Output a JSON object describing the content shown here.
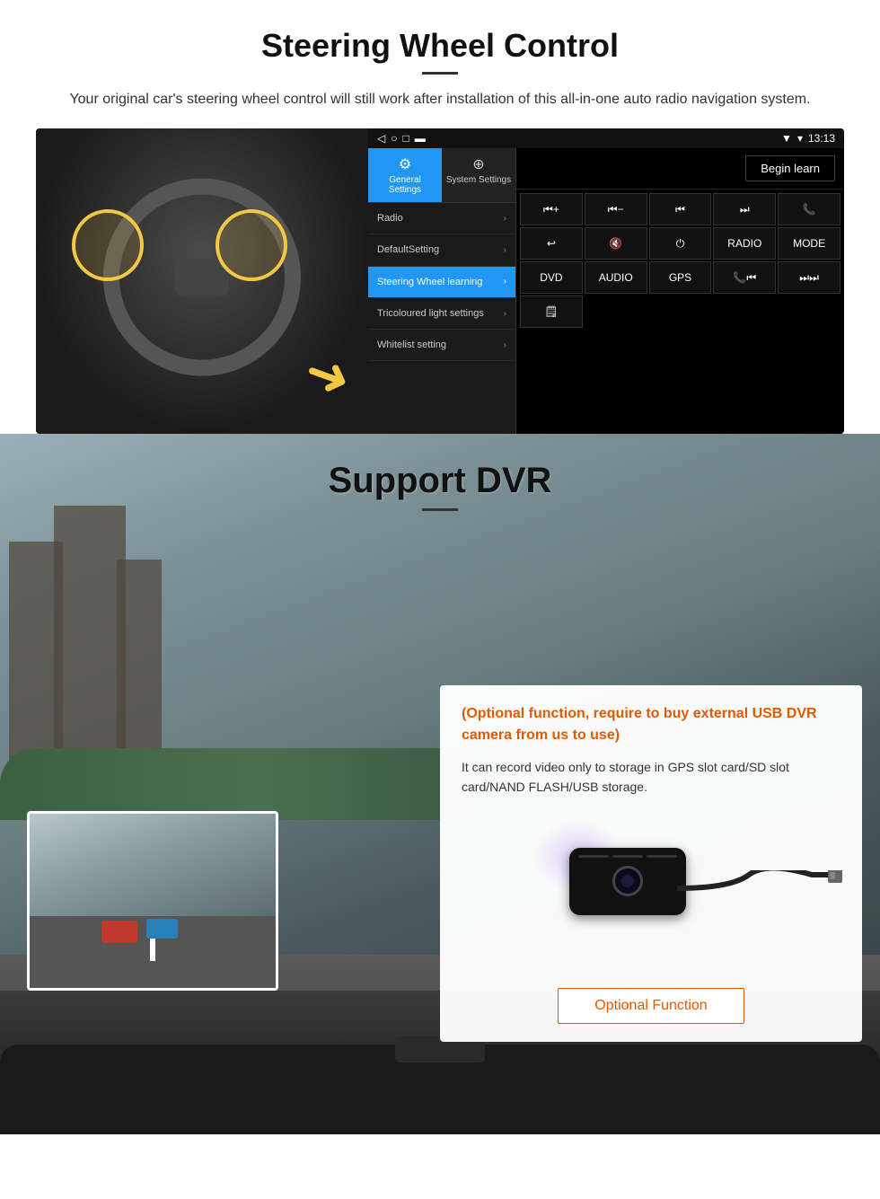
{
  "steering": {
    "title": "Steering Wheel Control",
    "subtitle": "Your original car's steering wheel control will still work after installation of this all-in-one auto radio navigation system.",
    "tabs": {
      "general": "General Settings",
      "system": "System Settings"
    },
    "menu": [
      {
        "label": "Radio",
        "active": false
      },
      {
        "label": "DefaultSetting",
        "active": false
      },
      {
        "label": "Steering Wheel learning",
        "active": true
      },
      {
        "label": "Tricoloured light settings",
        "active": false
      },
      {
        "label": "Whitelist setting",
        "active": false
      }
    ],
    "begin_learn": "Begin learn",
    "controls": [
      "⏮+",
      "⏮−",
      "⏮⏮",
      "⏭⏭",
      "📞",
      "↩",
      "🔇×",
      "⏻",
      "RADIO",
      "MODE",
      "DVD",
      "AUDIO",
      "GPS",
      "📞⏮",
      "⏭⏭",
      "🗒"
    ],
    "statusbar": {
      "time": "13:13",
      "signal": "▾▴",
      "wifi": "▾"
    }
  },
  "dvr": {
    "title": "Support DVR",
    "optional_text": "(Optional function, require to buy external USB DVR camera from us to use)",
    "desc_text": "It can record video only to storage in GPS slot card/SD slot card/NAND FLASH/USB storage.",
    "optional_btn": "Optional Function"
  }
}
